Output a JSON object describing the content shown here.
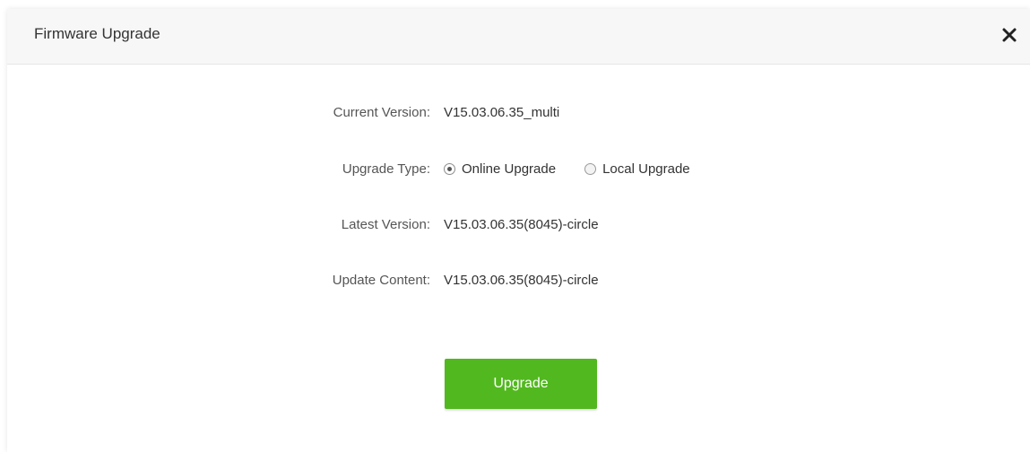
{
  "dialog": {
    "title": "Firmware Upgrade",
    "close_icon": "close-icon"
  },
  "fields": {
    "current_version": {
      "label": "Current Version:",
      "value": "V15.03.06.35_multi"
    },
    "upgrade_type": {
      "label": "Upgrade Type:",
      "options": [
        {
          "label": "Online Upgrade",
          "selected": true
        },
        {
          "label": "Local Upgrade",
          "selected": false
        }
      ]
    },
    "latest_version": {
      "label": "Latest Version:",
      "value": "V15.03.06.35(8045)-circle"
    },
    "update_content": {
      "label": "Update Content:",
      "value": "V15.03.06.35(8045)-circle"
    }
  },
  "actions": {
    "upgrade_label": "Upgrade"
  },
  "colors": {
    "accent": "#52b81f",
    "header_bg": "#f7f7f7",
    "text": "#333333"
  }
}
